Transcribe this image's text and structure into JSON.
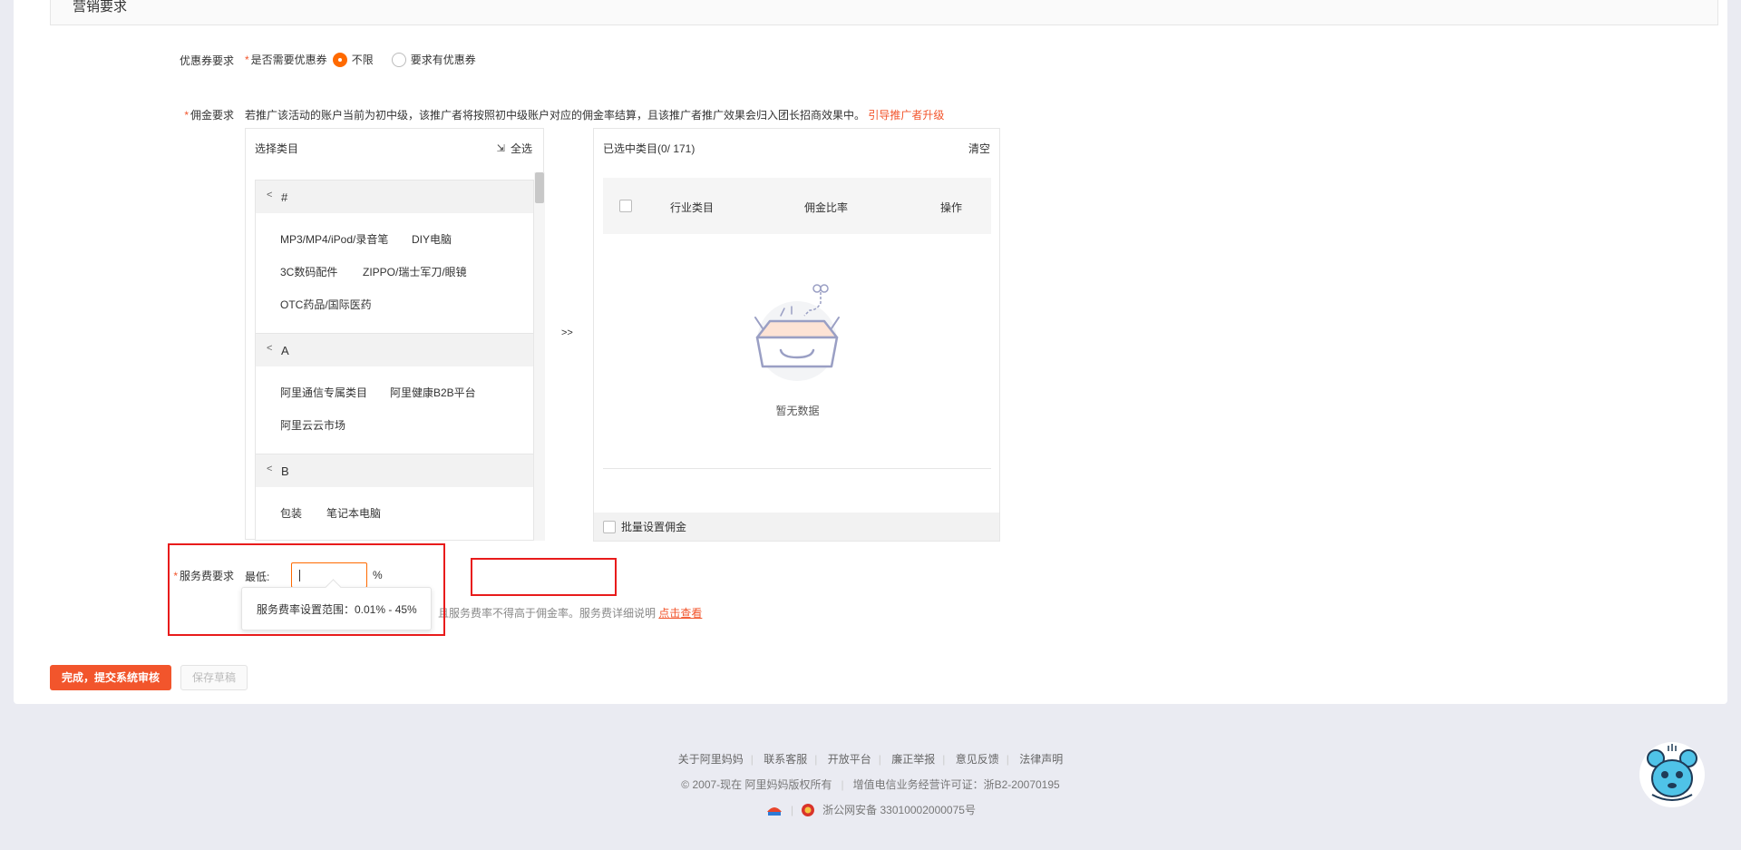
{
  "section": {
    "title": "营销要求"
  },
  "coupon": {
    "label": "优惠券要求",
    "question": "是否需要优惠券",
    "options": [
      {
        "label": "不限",
        "selected": true
      },
      {
        "label": "要求有优惠券",
        "selected": false
      }
    ]
  },
  "commission": {
    "label": "佣金要求",
    "note": "若推广该活动的账户当前为初中级，该推广者将按照初中级账户对应的佣金率结算，且该推广者推广效果会归入团长招商效果中。",
    "link": "引导推广者升级",
    "left_panel": {
      "title": "选择类目",
      "select_all": "全选",
      "select_all_icon": "select-all-icon",
      "groups": [
        {
          "letter": "#",
          "items": [
            "MP3/MP4/iPod/录音笔",
            "DIY电脑",
            "3C数码配件",
            "ZIPPO/瑞士军刀/眼镜",
            "OTC药品/国际医药"
          ]
        },
        {
          "letter": "A",
          "items": [
            "阿里通信专属类目",
            "阿里健康B2B平台",
            "阿里云云市场"
          ]
        },
        {
          "letter": "B",
          "items": [
            "包装",
            "笔记本电脑"
          ]
        }
      ]
    },
    "transfer": ">>",
    "right_panel": {
      "title": "已选中类目(0/ 171)",
      "clear": "清空",
      "columns": [
        "行业类目",
        "佣金比率",
        "操作"
      ],
      "empty_text": "暂无数据",
      "batch": "批量设置佣金"
    }
  },
  "service_fee": {
    "label": "服务费要求",
    "min_label": "最低:",
    "unit": "%",
    "hint_tail": "，且服务费率不得高于佣金率。服务费详细说明",
    "hint_link": "点击查看",
    "tooltip": "服务费率设置范围：0.01% - 45%"
  },
  "actions": {
    "submit": "完成，提交系统审核",
    "draft": "保存草稿"
  },
  "footer": {
    "links": [
      "关于阿里妈妈",
      "联系客服",
      "开放平台",
      "廉正举报",
      "意见反馈",
      "法律声明"
    ],
    "copyright": "© 2007-现在 阿里妈妈版权所有",
    "license": "增值电信业务经营许可证：浙B2-20070195",
    "police": "浙公网安备 33010002000075号"
  },
  "colors": {
    "accent": "#f2552c",
    "brand_orange": "#ff6a00",
    "page_bg": "#eaebf2",
    "annotation_red": "#e81b1b"
  }
}
